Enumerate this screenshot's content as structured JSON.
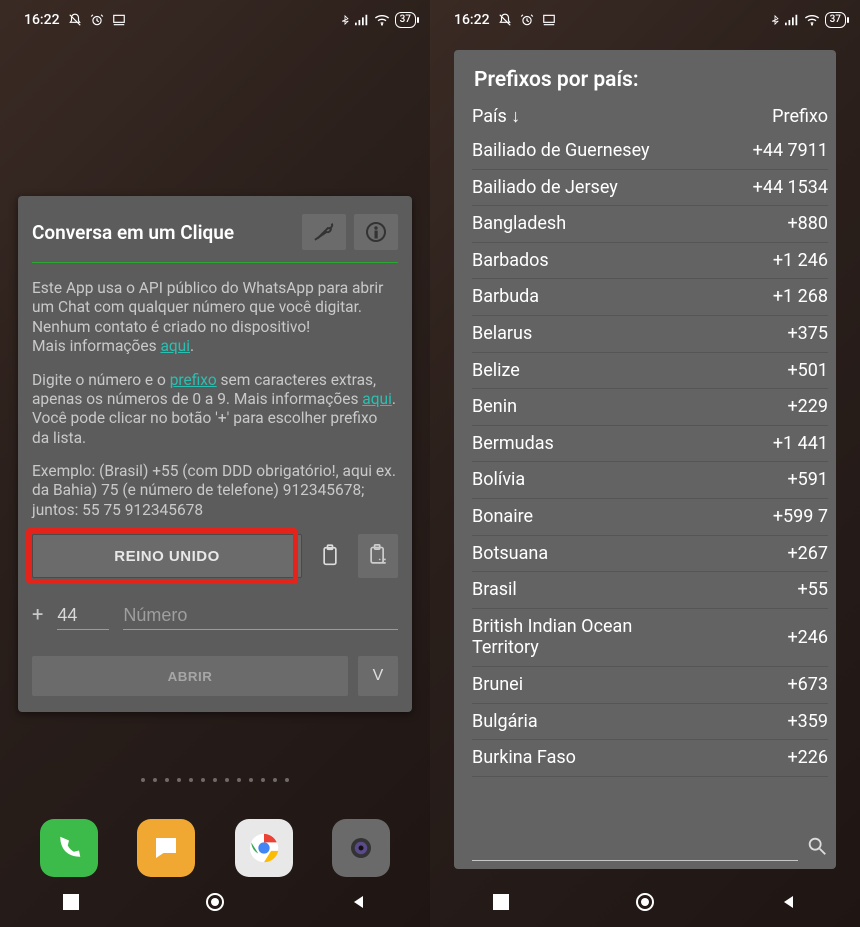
{
  "status": {
    "time": "16:22",
    "battery": "37"
  },
  "card": {
    "title": "Conversa em um Clique",
    "para1_1": "Este App usa o API público do WhatsApp para abrir um Chat com qualquer número que você digitar. Nenhum contato é criado no dispositivo!",
    "para1_more": "Mais informações ",
    "link_aqui": "aqui",
    "para2_1": "Digite o número e o ",
    "link_prefix": "prefixo",
    "para2_2": " sem caracteres extras, apenas os números de 0 a 9. Mais informações ",
    "para2_3": ". Você pode clicar no botão '+' para escolher prefixo da lista.",
    "para3": "Exemplo: (Brasil) +55 (com DDD obrigatório!, aqui ex. da Bahia) 75 (e número de telefone) 912345678; juntos: 55 75 912345678",
    "country_btn": "REINO UNIDO",
    "plus": "+",
    "prefix_value": "44",
    "number_placeholder": "Número",
    "abrir": "ABRIR",
    "v": "V"
  },
  "prefix_dialog": {
    "title": "Prefixos por país:",
    "col_country": "País ↓",
    "col_prefix": "Prefixo",
    "rows": [
      {
        "name": "Bailiado de Guernesey",
        "code": "+44 7911"
      },
      {
        "name": "Bailiado de Jersey",
        "code": "+44 1534"
      },
      {
        "name": "Bangladesh",
        "code": "+880"
      },
      {
        "name": "Barbados",
        "code": "+1 246"
      },
      {
        "name": "Barbuda",
        "code": "+1 268"
      },
      {
        "name": "Belarus",
        "code": "+375"
      },
      {
        "name": "Belize",
        "code": "+501"
      },
      {
        "name": "Benin",
        "code": "+229"
      },
      {
        "name": "Bermudas",
        "code": "+1 441"
      },
      {
        "name": "Bolívia",
        "code": "+591"
      },
      {
        "name": "Bonaire",
        "code": "+599 7"
      },
      {
        "name": "Botsuana",
        "code": "+267"
      },
      {
        "name": "Brasil",
        "code": "+55"
      },
      {
        "name": "British Indian Ocean Territory",
        "code": "+246"
      },
      {
        "name": "Brunei",
        "code": "+673"
      },
      {
        "name": "Bulgária",
        "code": "+359"
      },
      {
        "name": "Burkina Faso",
        "code": "+226"
      }
    ]
  }
}
